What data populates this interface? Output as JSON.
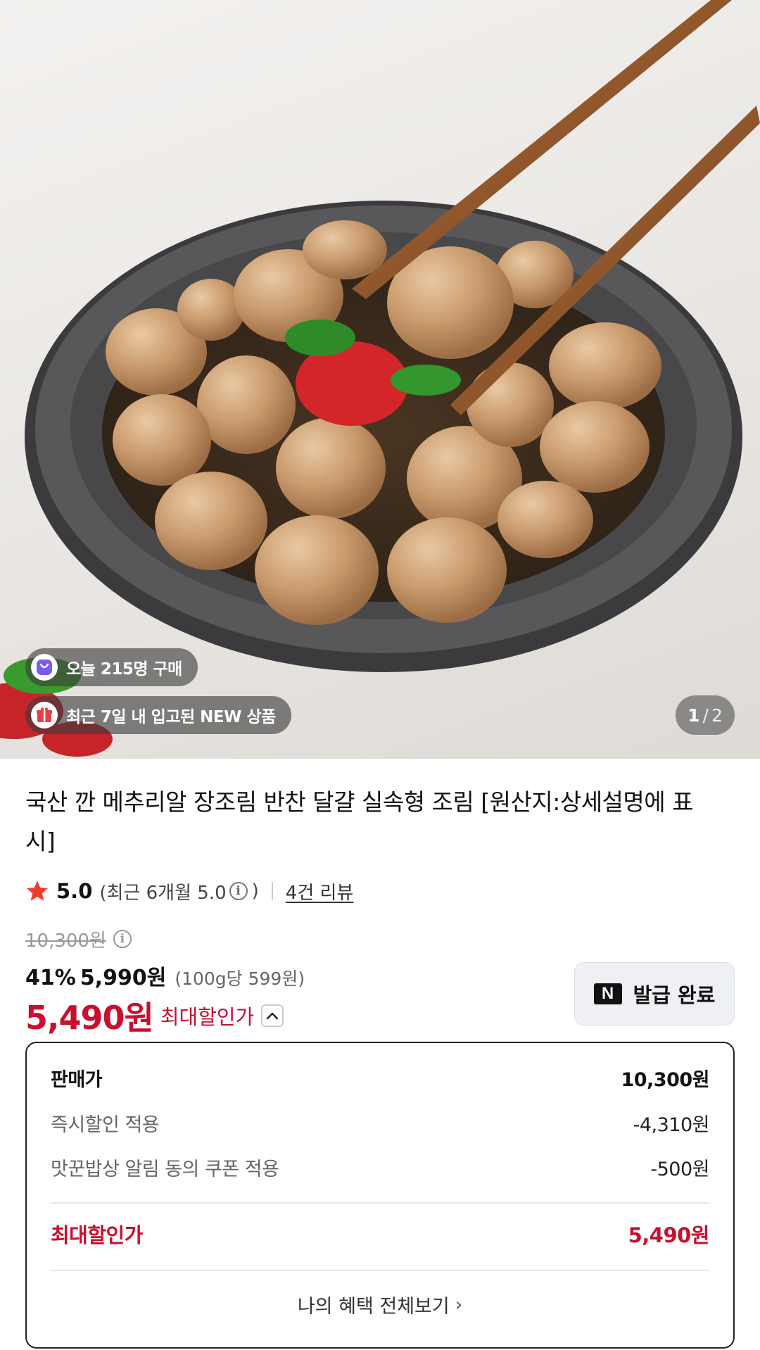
{
  "hero": {
    "badges": [
      {
        "text": "오늘 215명 구매",
        "icon": "shopping-bag-icon"
      },
      {
        "text": "최근 7일 내 입고된 NEW 상품",
        "icon": "gift-icon"
      }
    ],
    "pager": {
      "current": "1",
      "separator": "/",
      "total": "2"
    }
  },
  "product": {
    "title": "국산 깐 메추리알 장조림 반찬 달걀 실속형 조림 [원산지:상세설명에 표시]",
    "rating": {
      "score": "5.0",
      "recent_open": "(최근 6개월 5.0",
      "recent_close": ")",
      "info_icon": "i",
      "reviews": "4건 리뷰"
    },
    "original_price": "10,300원",
    "discount_percent": "41%",
    "sale_price": "5,990원",
    "unit_price": "(100g당 599원)",
    "max_price_number": "5,490원",
    "max_price_label": "최대할인가"
  },
  "coupon_button": {
    "logo": "N",
    "label": "발급 완료"
  },
  "breakdown": {
    "rows": [
      {
        "label": "판매가",
        "value": "10,300원"
      },
      {
        "label": "즉시할인 적용",
        "value": "-4,310원"
      },
      {
        "label": "맛꾼밥상 알림 동의 쿠폰 적용",
        "value": "-500원"
      }
    ],
    "total": {
      "label": "최대할인가",
      "value": "5,490원"
    },
    "more_link": "나의 혜택 전체보기",
    "more_arrow": "›"
  },
  "colors": {
    "accent_red": "#c8102e",
    "badge_purple": "#7b5cf0",
    "badge_red": "#e2414a"
  }
}
